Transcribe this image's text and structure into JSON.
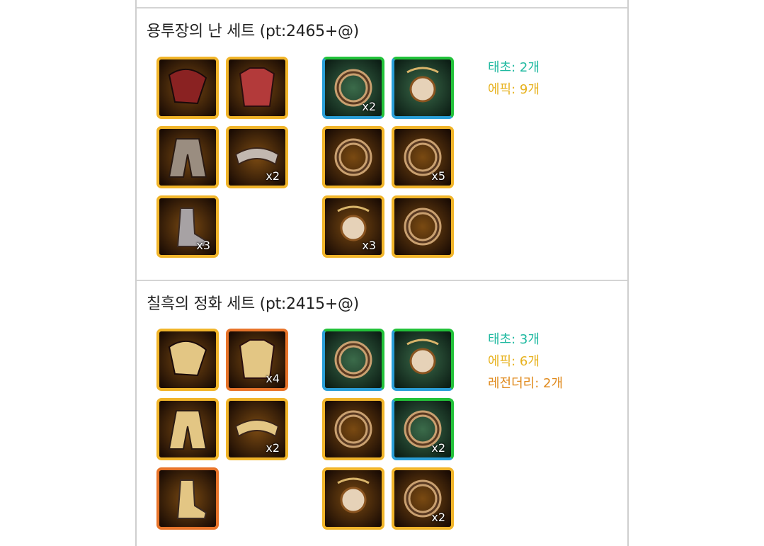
{
  "colors": {
    "epic": "#f1b52a",
    "legendary": "#e8742a",
    "taecho_top": "#22c23a",
    "taecho_bottom": "#2a9fd8",
    "stat_taecho": "#1fb9a0",
    "stat_epic": "#e7b21f",
    "stat_legendary": "#e08a1c"
  },
  "sets": [
    {
      "title": "용투장의 난 세트 (pt:2465+@)",
      "armor": [
        {
          "icon": "dragon-shoulder-icon",
          "rarity": "epic",
          "count": ""
        },
        {
          "icon": "red-chest-armor-icon",
          "rarity": "epic",
          "count": ""
        },
        {
          "icon": "spiked-pants-icon",
          "rarity": "epic",
          "count": ""
        },
        {
          "icon": "silver-belt-icon",
          "rarity": "epic",
          "count": "x2"
        },
        {
          "icon": "spiked-boots-icon",
          "rarity": "epic",
          "count": "x3"
        }
      ],
      "accessories": [
        {
          "icon": "claw-bracelet-icon",
          "rarity": "taecho",
          "count": "x2"
        },
        {
          "icon": "dragon-necklace-icon",
          "rarity": "taecho",
          "count": ""
        },
        {
          "icon": "blade-ring-icon",
          "rarity": "epic",
          "count": ""
        },
        {
          "icon": "studded-ring-icon",
          "rarity": "epic",
          "count": "x5"
        },
        {
          "icon": "horn-stone-icon",
          "rarity": "epic",
          "count": "x3"
        },
        {
          "icon": "pearl-earring-icon",
          "rarity": "epic",
          "count": ""
        }
      ],
      "stats": [
        {
          "label": "태초: 2개",
          "kind": "taecho"
        },
        {
          "label": "에픽: 9개",
          "kind": "epic"
        }
      ]
    },
    {
      "title": "칠흑의 정화 세트 (pt:2415+@)",
      "armor": [
        {
          "icon": "gold-shoulder-icon",
          "rarity": "epic",
          "count": ""
        },
        {
          "icon": "white-chest-armor-icon",
          "rarity": "legendary",
          "count": "x4"
        },
        {
          "icon": "gold-skirt-icon",
          "rarity": "epic",
          "count": ""
        },
        {
          "icon": "gold-belt-icon",
          "rarity": "epic",
          "count": "x2"
        },
        {
          "icon": "gold-boots-icon",
          "rarity": "legendary",
          "count": ""
        }
      ],
      "accessories": [
        {
          "icon": "rose-bracelet-icon",
          "rarity": "taecho",
          "count": ""
        },
        {
          "icon": "leaf-necklace-icon",
          "rarity": "taecho",
          "count": ""
        },
        {
          "icon": "goblet-ring-icon",
          "rarity": "epic",
          "count": ""
        },
        {
          "icon": "gem-ring-icon",
          "rarity": "taecho",
          "count": "x2"
        },
        {
          "icon": "sun-stone-icon",
          "rarity": "epic",
          "count": ""
        },
        {
          "icon": "compass-earring-icon",
          "rarity": "epic",
          "count": "x2"
        }
      ],
      "stats": [
        {
          "label": "태초: 3개",
          "kind": "taecho"
        },
        {
          "label": "에픽: 6개",
          "kind": "epic"
        },
        {
          "label": "레전더리: 2개",
          "kind": "legendary"
        }
      ]
    }
  ]
}
